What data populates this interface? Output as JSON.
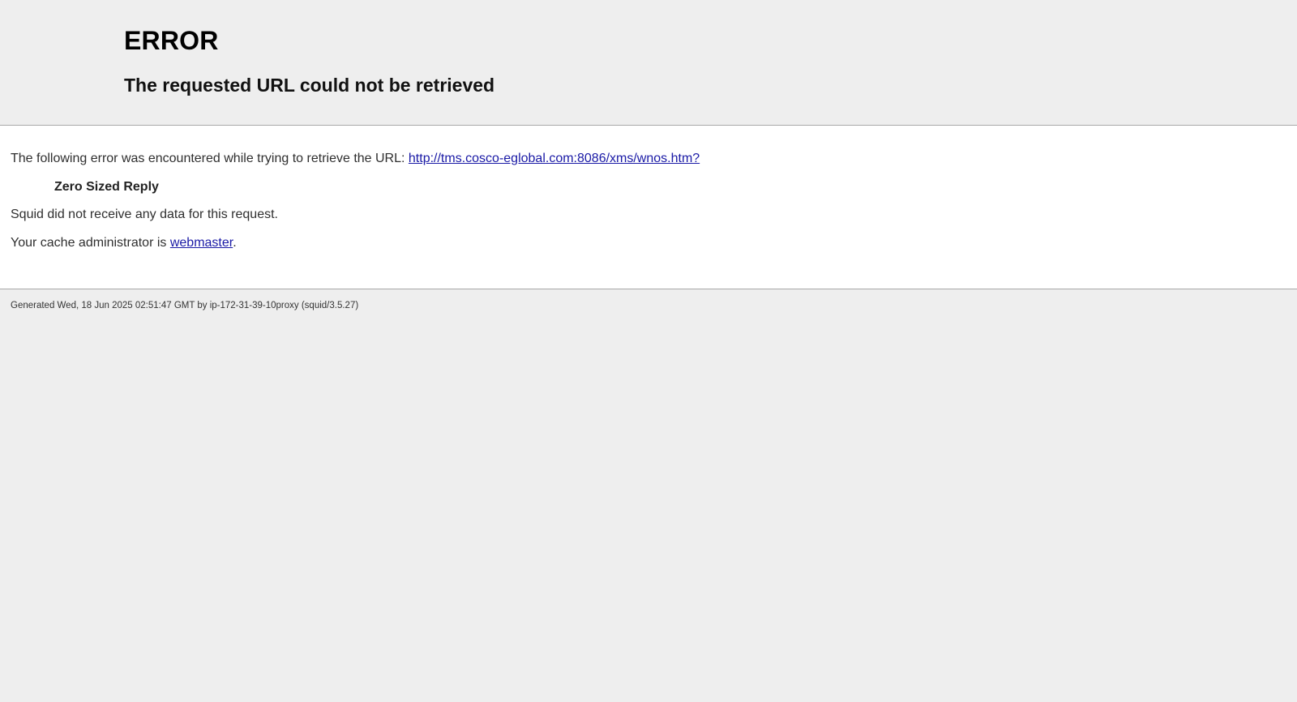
{
  "titles": {
    "error": "ERROR",
    "subtitle": "The requested URL could not be retrieved"
  },
  "content": {
    "intro_text": "The following error was encountered while trying to retrieve the URL: ",
    "url_link": "http://tms.cosco-eglobal.com:8086/xms/wnos.htm?",
    "error_name": "Zero Sized Reply",
    "description": "Squid did not receive any data for this request.",
    "admin_prefix": "Your cache administrator is ",
    "admin_link": "webmaster",
    "admin_suffix": "."
  },
  "footer": {
    "generated": "Generated Wed, 18 Jun 2025 02:51:47 GMT by ip-172-31-39-10proxy (squid/3.5.27)"
  },
  "colors": {
    "page_background": "#eeeeee",
    "content_background": "#ffffff",
    "link": "#1a1aa6"
  }
}
